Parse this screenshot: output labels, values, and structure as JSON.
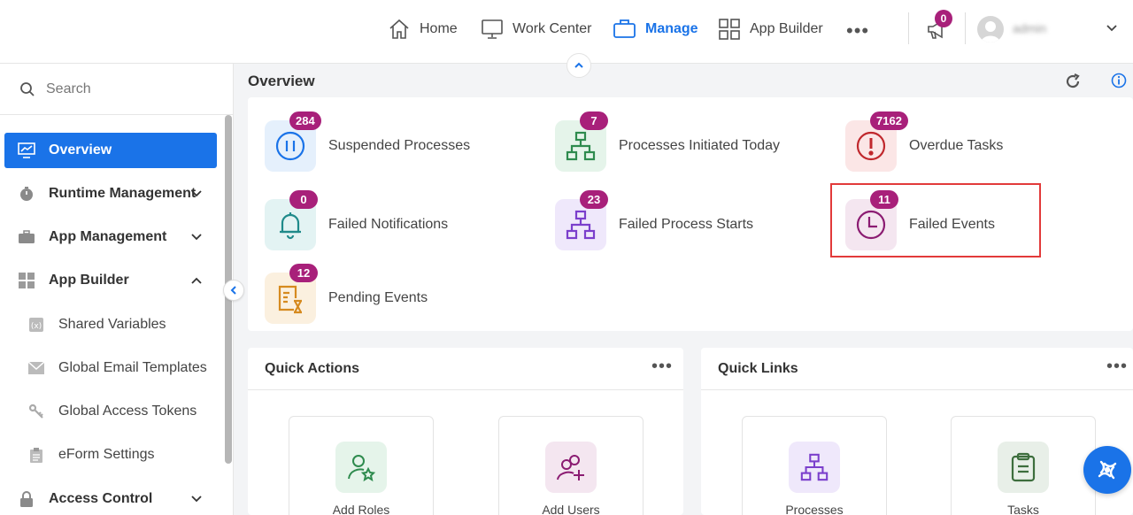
{
  "topnav": {
    "home": "Home",
    "work_center": "Work Center",
    "manage": "Manage",
    "app_builder": "App Builder",
    "notifications_count": "0",
    "username": "admin"
  },
  "sidebar": {
    "search_placeholder": "Search",
    "items": [
      {
        "label": "Overview",
        "icon": "chart-icon"
      },
      {
        "label": "Runtime Management",
        "icon": "timer-icon"
      },
      {
        "label": "App Management",
        "icon": "briefcase-icon"
      },
      {
        "label": "App Builder",
        "icon": "grid-icon"
      },
      {
        "label": "Access Control",
        "icon": "lock-icon"
      }
    ],
    "sub_items": [
      {
        "label": "Shared Variables",
        "icon": "variable-icon"
      },
      {
        "label": "Global Email Templates",
        "icon": "email-icon"
      },
      {
        "label": "Global Access Tokens",
        "icon": "key-icon"
      },
      {
        "label": "eForm Settings",
        "icon": "clipboard-icon"
      }
    ]
  },
  "main": {
    "title": "Overview",
    "stats": [
      {
        "label": "Suspended Processes",
        "count": "284",
        "icon": "pause-icon"
      },
      {
        "label": "Processes Initiated Today",
        "count": "7",
        "icon": "hierarchy-icon"
      },
      {
        "label": "Overdue Tasks",
        "count": "7162",
        "icon": "alert-icon"
      },
      {
        "label": "Failed Notifications",
        "count": "0",
        "icon": "bell-icon"
      },
      {
        "label": "Failed Process Starts",
        "count": "23",
        "icon": "hierarchy-icon"
      },
      {
        "label": "Failed Events",
        "count": "11",
        "icon": "clock-icon"
      },
      {
        "label": "Pending Events",
        "count": "12",
        "icon": "hourglass-doc-icon"
      }
    ],
    "quick_actions": {
      "title": "Quick Actions",
      "tiles": [
        {
          "label": "Add Roles",
          "icon": "user-star-icon"
        },
        {
          "label": "Add Users",
          "icon": "user-add-icon"
        }
      ]
    },
    "quick_links": {
      "title": "Quick Links",
      "tiles": [
        {
          "label": "Processes",
          "icon": "hierarchy-icon"
        },
        {
          "label": "Tasks",
          "icon": "clipboard-icon"
        }
      ]
    }
  },
  "colors": {
    "accent": "#1a73e8",
    "badge": "#a8207a",
    "highlight": "#e23a3a"
  }
}
